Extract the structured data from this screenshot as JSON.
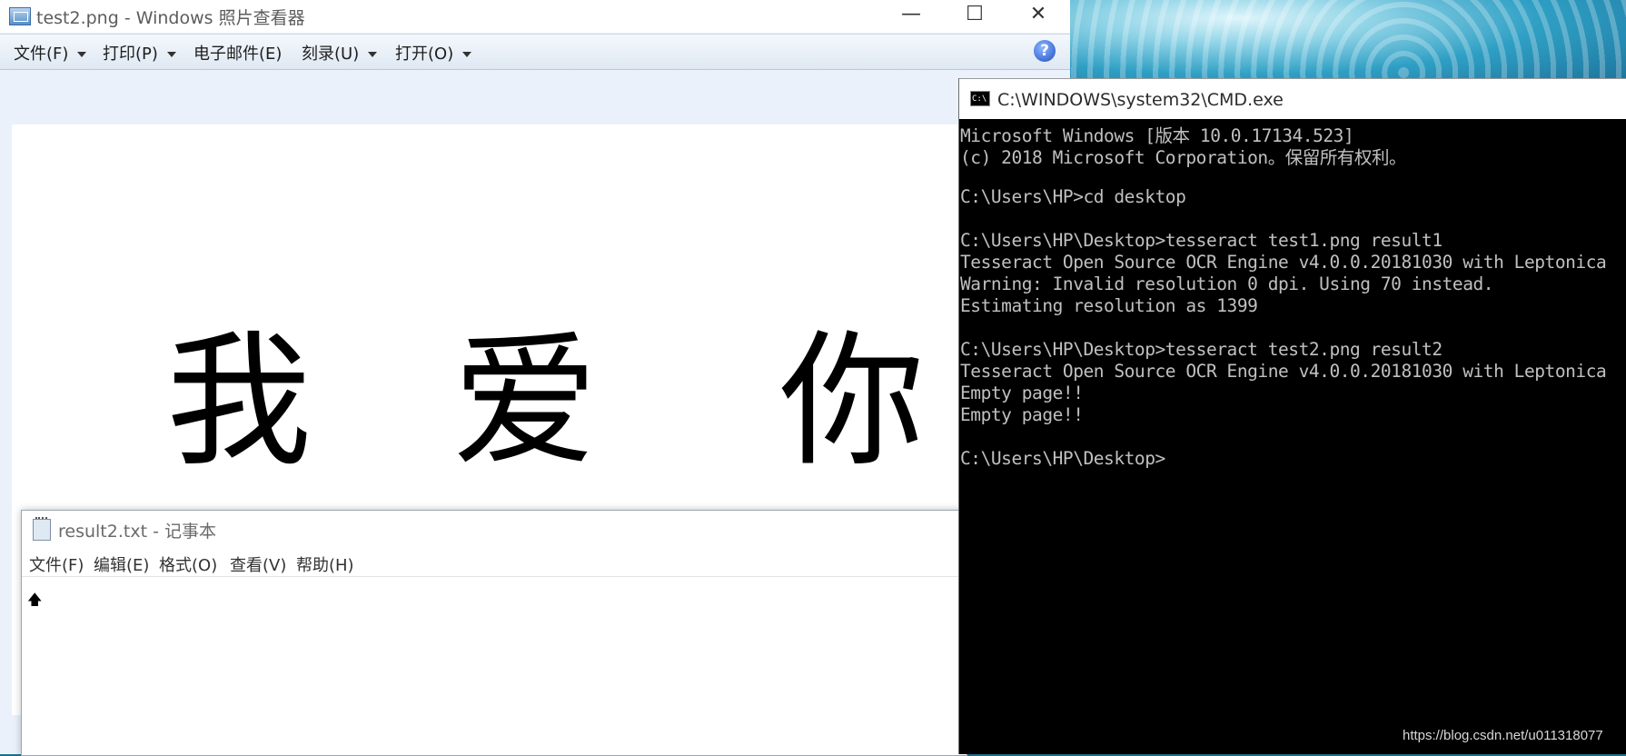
{
  "photo_viewer": {
    "title": "test2.png - Windows 照片查看器",
    "menu": [
      "文件(F)",
      "打印(P)",
      "电子邮件(E)",
      "刻录(U)",
      "打开(O)"
    ],
    "image_chars": [
      "我",
      "爱",
      "你"
    ],
    "controls": {
      "minimize": "—",
      "maximize": "☐",
      "close": "✕",
      "help": "?"
    }
  },
  "notepad": {
    "title": "result2.txt - 记事本",
    "menu": [
      "文件(F)",
      "编辑(E)",
      "格式(O)",
      "查看(V)",
      "帮助(H)"
    ],
    "content_glyph": "🡅"
  },
  "cmd": {
    "title": "C:\\WINDOWS\\system32\\CMD.exe",
    "icon_text": "C:\\",
    "lines": [
      "Microsoft Windows [版本 10.0.17134.523]",
      "(c) 2018 Microsoft Corporation。保留所有权利。",
      "",
      "C:\\Users\\HP>cd desktop",
      "",
      "C:\\Users\\HP\\Desktop>tesseract test1.png result1",
      "Tesseract Open Source OCR Engine v4.0.0.20181030 with Leptonica",
      "Warning: Invalid resolution 0 dpi. Using 70 instead.",
      "Estimating resolution as 1399",
      "",
      "C:\\Users\\HP\\Desktop>tesseract test2.png result2",
      "Tesseract Open Source OCR Engine v4.0.0.20181030 with Leptonica",
      "Empty page!!",
      "Empty page!!",
      "",
      "C:\\Users\\HP\\Desktop>"
    ]
  },
  "watermark": "https://blog.csdn.net/u011318077"
}
